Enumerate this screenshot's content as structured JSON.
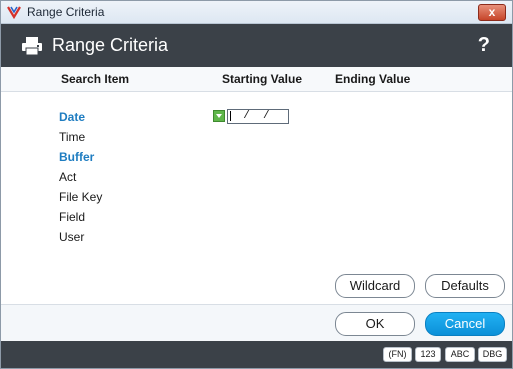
{
  "window": {
    "title": "Range Criteria",
    "close_label": "x"
  },
  "header": {
    "title": "Range Criteria",
    "help_label": "?"
  },
  "columns": {
    "search_item": "Search Item",
    "starting_value": "Starting Value",
    "ending_value": "Ending Value"
  },
  "items": [
    {
      "label": "Date",
      "style": "link"
    },
    {
      "label": "Time",
      "style": "plain"
    },
    {
      "label": "Buffer",
      "style": "link"
    },
    {
      "label": "Act",
      "style": "plain"
    },
    {
      "label": "File Key",
      "style": "plain"
    },
    {
      "label": "Field",
      "style": "plain"
    },
    {
      "label": "User",
      "style": "plain"
    }
  ],
  "date_input": {
    "value": "  /  /  "
  },
  "buttons": {
    "wildcard": "Wildcard",
    "defaults": "Defaults",
    "ok": "OK",
    "cancel": "Cancel"
  },
  "statusbar": {
    "badges": [
      "(FN)",
      "123",
      "ABC",
      "DBG"
    ]
  },
  "colors": {
    "accent": "#1f7dc1",
    "header_bg": "#3b4148",
    "primary_button": "#0c90d8"
  }
}
